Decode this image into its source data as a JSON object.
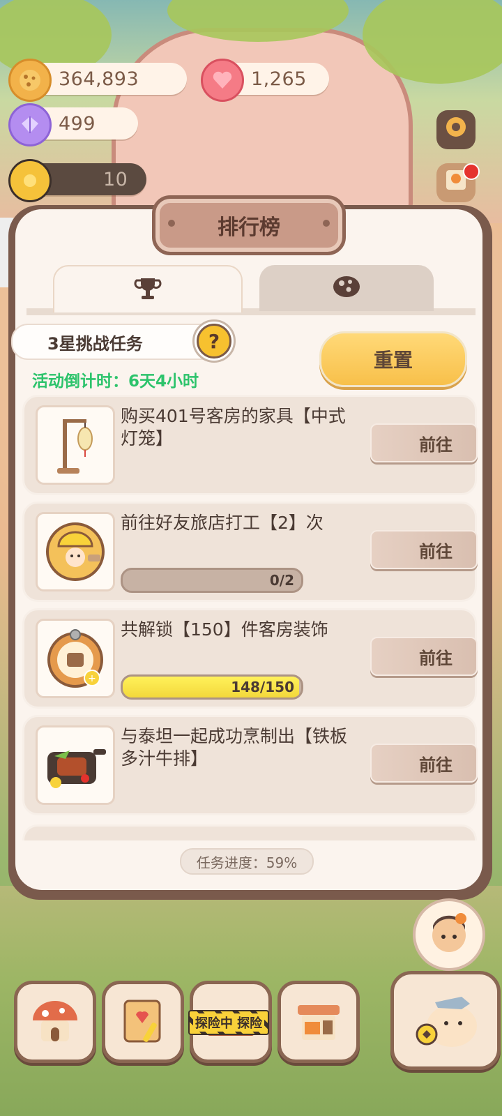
{
  "currency": {
    "cookies": "364,893",
    "hearts": "1,265",
    "gems": "499",
    "helpers": "10"
  },
  "panel": {
    "title": "排行榜",
    "challenge_title": "3星挑战任务",
    "help_symbol": "?",
    "reset_label": "重置",
    "countdown": "活动倒计时：6天4小时",
    "progress": "任务进度：59%"
  },
  "side": {
    "expand_arrow": "⟩"
  },
  "tasks": [
    {
      "desc": "购买401号客房的家具【中式灯笼】",
      "button": "前往"
    },
    {
      "desc": "前往好友旅店打工【2】次",
      "button": "前往",
      "progress_text": "0/2",
      "progress_fraction": 0
    },
    {
      "desc": "共解锁【150】件客房装饰",
      "button": "前往",
      "progress_text": "148/150",
      "progress_fraction": 0.987
    },
    {
      "desc": "与泰坦一起成功烹制出【铁板多汁牛排】",
      "button": "前往"
    }
  ],
  "nav": {
    "explore_badge": "探险中 探险"
  },
  "colors": {
    "panel_border": "#7a5a4c",
    "panel_bg": "#fbf4ee",
    "countdown_green": "#2cc36b",
    "reset_yellow": "#f8c04a",
    "progress_fill": "#f3d83b"
  }
}
